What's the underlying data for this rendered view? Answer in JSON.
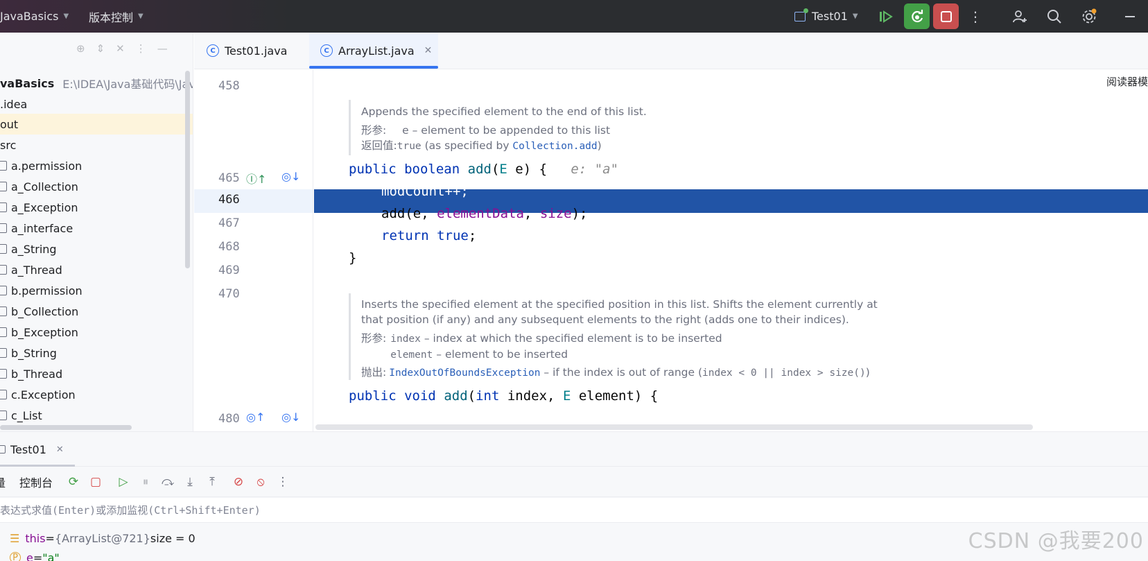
{
  "window": {
    "project_name": "JavaBasics",
    "vcs_menu": "版本控制",
    "run_config": "Test01"
  },
  "project_tree": {
    "root_name": "vaBasics",
    "root_path": "E:\\IDEA\\Java基础代码\\Java",
    "items": [
      {
        "label": ".idea",
        "kind": "plain"
      },
      {
        "label": "out",
        "kind": "plain"
      },
      {
        "label": "src",
        "kind": "plain"
      },
      {
        "label": "a.permission",
        "kind": "folder"
      },
      {
        "label": "a_Collection",
        "kind": "folder"
      },
      {
        "label": "a_Exception",
        "kind": "folder"
      },
      {
        "label": "a_interface",
        "kind": "folder"
      },
      {
        "label": "a_String",
        "kind": "folder"
      },
      {
        "label": "a_Thread",
        "kind": "folder"
      },
      {
        "label": "b.permission",
        "kind": "folder"
      },
      {
        "label": "b_Collection",
        "kind": "folder"
      },
      {
        "label": "b_Exception",
        "kind": "folder"
      },
      {
        "label": "b_String",
        "kind": "folder"
      },
      {
        "label": "b_Thread",
        "kind": "folder"
      },
      {
        "label": "c.Exception",
        "kind": "folder"
      },
      {
        "label": "c_List",
        "kind": "folder"
      }
    ]
  },
  "tabs": [
    {
      "label": "Test01.java",
      "active": false
    },
    {
      "label": "ArrayList.java",
      "active": true
    }
  ],
  "editor": {
    "reader_mode": "阅读器模",
    "line_numbers": [
      "458",
      "465",
      "466",
      "467",
      "468",
      "469",
      "470",
      "480"
    ],
    "doc1": {
      "summary": "Appends the specified element to the end of this list.",
      "param_label": "形参:",
      "param_text": "e – element to be appended to this list",
      "return_label": "返回值:",
      "return_code": "true",
      "return_text": " (as specified by ",
      "return_link": "Collection.add",
      "return_tail": ")"
    },
    "code": {
      "l465_kw1": "public",
      "l465_kw2": "boolean",
      "l465_fn": "add",
      "l465_open": "(",
      "l465_type": "E",
      "l465_rest": " e) {",
      "l465_hint": "e: \"a\"",
      "l466": "modCount++;",
      "l467_a": "add(e, ",
      "l467_f1": "elementData",
      "l467_b": ", ",
      "l467_f2": "size",
      "l467_c": ");",
      "l468_kw1": "return",
      "l468_kw2": "true",
      "l468_end": ";",
      "l469": "}",
      "l480_kw1": "public",
      "l480_kw2": "void",
      "l480_fn": "add",
      "l480_open": "(",
      "l480_kw3": "int",
      "l480_mid": " index, ",
      "l480_type": "E",
      "l480_rest": " element) {"
    },
    "doc2": {
      "summary1": "Inserts the specified element at the specified position in this list. Shifts the element currently at",
      "summary2": "that position (if any) and any subsequent elements to the right (adds one to their indices).",
      "param_label": "形参:",
      "param1_code": "index",
      "param1_text": " – index at which the specified element is to be inserted",
      "param2_code": "element",
      "param2_text": " – element to be inserted",
      "throws_label": "抛出:",
      "throws_link": "IndexOutOfBoundsException",
      "throws_text": " – if the index is out of range (",
      "throws_code": "index < 0 || index > size()",
      "throws_tail": ")"
    }
  },
  "debug": {
    "session_tab": "Test01",
    "left_tab_fragment": "量",
    "console_tab": "控制台",
    "eval_placeholder": "表达式求值(Enter)或添加监视(Ctrl+Shift+Enter)",
    "vars": [
      {
        "name": "this",
        "eq": " = ",
        "value": "{ArrayList@721}",
        "extra": "  size = 0"
      },
      {
        "name": "e",
        "eq": " = ",
        "value": "\"a\"",
        "extra": ""
      }
    ]
  },
  "watermark": "CSDN @我要200",
  "colors": {
    "accent": "#3574f0",
    "exec_line": "#2154a6",
    "run_green": "#43a047",
    "stop_red": "#c94f4f"
  }
}
